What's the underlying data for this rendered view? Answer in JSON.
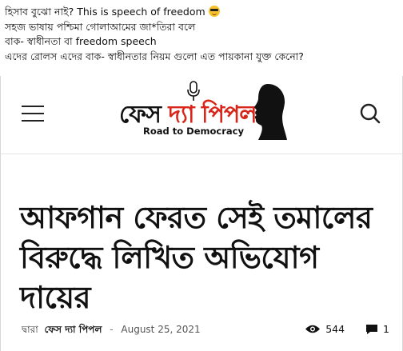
{
  "post": {
    "lines": [
      "হিসাব বুঝো নাই? This is speech of freedom",
      "সহজ ভাষায় পশ্চিমা গোলাআমের  জা*তিরা বলে",
      "বাক- স্বাধীনতা  বা freedom speech",
      "এদের রোলস এদের বাক- স্বাধীনতার নিয়ম গুলো এত পায়কানা যুক্ত কেনো?"
    ],
    "emoji": "sunglasses-emoji"
  },
  "site": {
    "logo_part1": "ফেস",
    "logo_part2": "দ্যা",
    "logo_part3": "পিপল",
    "tagline": "Road to Democracy",
    "accent_color": "#d8261a"
  },
  "article": {
    "headline": "আফগান ফেরত সেই তমালের বিরুদ্ধে লিখিত অভিযোগ দায়ের",
    "by_label": "দ্বারা",
    "author": "ফেস দ্যা পিপল",
    "separator": "-",
    "date": "August 25, 2021",
    "views": "544",
    "comments": "1"
  }
}
